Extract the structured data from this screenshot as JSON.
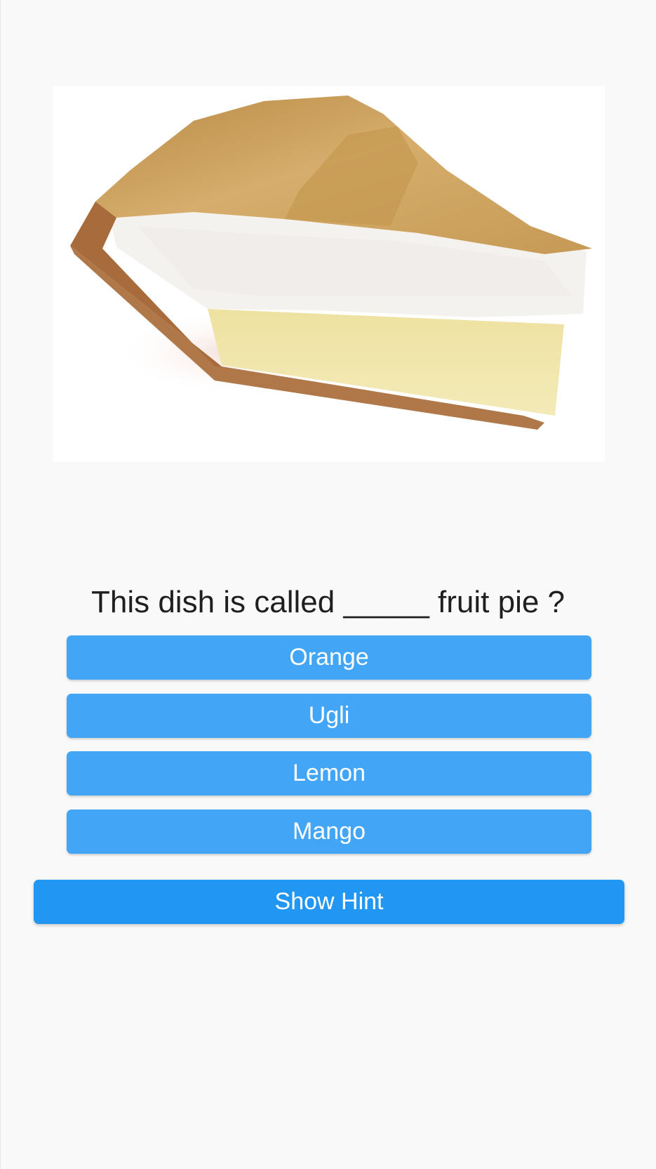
{
  "quiz": {
    "image_subject": "pie-slice-photo",
    "question": "This dish is called _____ fruit pie ?",
    "options": [
      {
        "label": "Orange"
      },
      {
        "label": "Ugli"
      },
      {
        "label": "Lemon"
      },
      {
        "label": "Mango"
      }
    ],
    "hint_label": "Show Hint"
  },
  "colors": {
    "background": "#f9f9f9",
    "option_button": "#42a5f5",
    "hint_button": "#2196f3",
    "button_text": "#ffffff",
    "question_text": "#1f1f1f"
  }
}
